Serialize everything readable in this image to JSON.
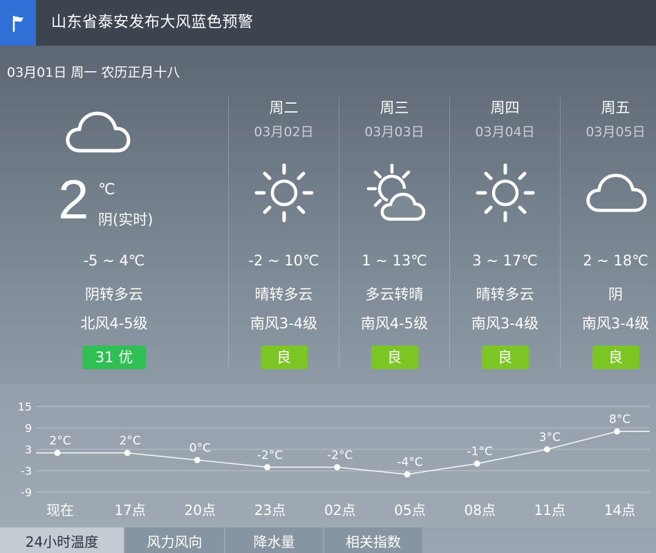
{
  "alert": {
    "title": "山东省泰安发布大风蓝色预警",
    "icon": "flag-icon",
    "icon_bg": "#2f6fd6"
  },
  "date_line": "03月01日 周一 农历正月十八",
  "today": {
    "icon": "cloud-icon",
    "temp": "2",
    "unit": "℃",
    "condition": "阴(实时)",
    "range": "-5 ~ 4℃",
    "weather": "阴转多云",
    "wind": "北风4-5级",
    "aqi": "31 优",
    "aqi_color": "#2fbf54"
  },
  "forecast": [
    {
      "weekday": "周二",
      "date": "03月02日",
      "icon": "sun-icon",
      "range": "-2 ~ 10℃",
      "weather": "晴转多云",
      "wind": "南风3-4级",
      "aqi": "良"
    },
    {
      "weekday": "周三",
      "date": "03月03日",
      "icon": "partly-cloudy-icon",
      "range": "1 ~ 13℃",
      "weather": "多云转晴",
      "wind": "南风4-5级",
      "aqi": "良"
    },
    {
      "weekday": "周四",
      "date": "03月04日",
      "icon": "sun-icon",
      "range": "3 ~ 17℃",
      "weather": "晴转多云",
      "wind": "南风3-4级",
      "aqi": "良"
    },
    {
      "weekday": "周五",
      "date": "03月05日",
      "icon": "cloud-icon",
      "range": "2 ~ 18℃",
      "weather": "阴",
      "wind": "南风3-4级",
      "aqi": "良"
    }
  ],
  "aqi_good_color": "#7cc623",
  "chart_data": {
    "type": "line",
    "categories": [
      "现在",
      "17点",
      "20点",
      "23点",
      "02点",
      "05点",
      "08点",
      "11点",
      "14点"
    ],
    "series": [
      {
        "values": [
          2,
          2,
          0,
          -2,
          -2,
          -4,
          -1,
          3,
          8
        ]
      }
    ],
    "data_labels": [
      "2°C",
      "2°C",
      "0°C",
      "-2°C",
      "-2°C",
      "-4°C",
      "-1°C",
      "3°C",
      "8°C"
    ],
    "yticks": [
      15,
      9,
      3,
      -3,
      -9
    ],
    "ylim": [
      -9,
      15
    ],
    "grid": true
  },
  "tabs": [
    {
      "label": "24小时温度",
      "active": true
    },
    {
      "label": "风力风向",
      "active": false
    },
    {
      "label": "降水量",
      "active": false
    },
    {
      "label": "相关指数",
      "active": false
    }
  ]
}
